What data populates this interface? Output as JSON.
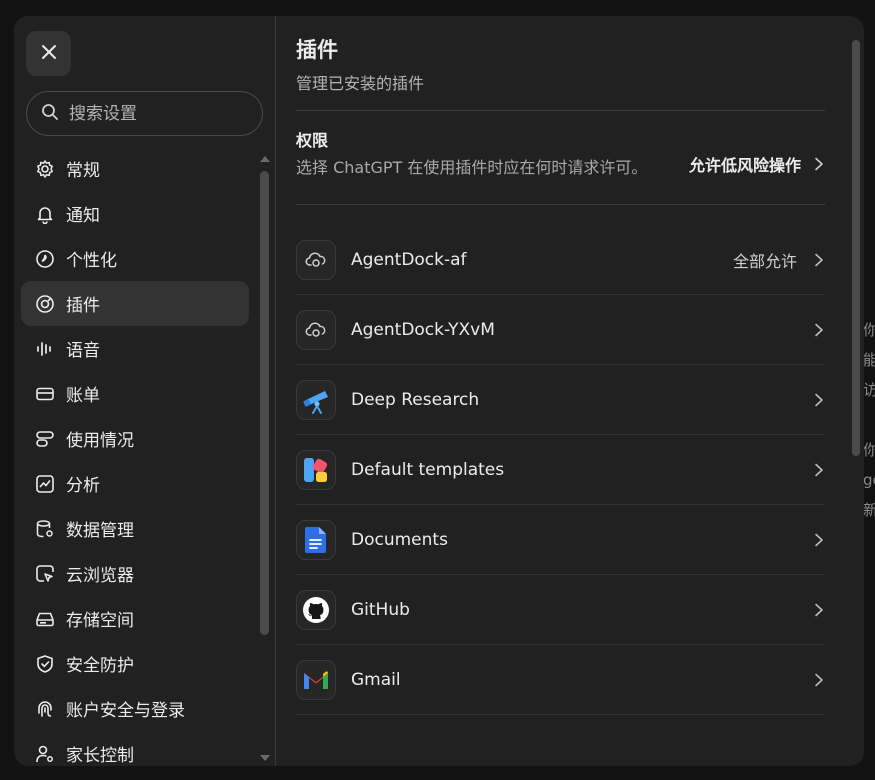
{
  "sidebar": {
    "search_placeholder": "搜索设置",
    "items": [
      {
        "label": "常规",
        "icon": "gear-icon"
      },
      {
        "label": "通知",
        "icon": "bell-icon"
      },
      {
        "label": "个性化",
        "icon": "personalization-icon"
      },
      {
        "label": "插件",
        "icon": "plugin-icon",
        "active": true
      },
      {
        "label": "语音",
        "icon": "voice-waveform-icon"
      },
      {
        "label": "账单",
        "icon": "credit-card-icon"
      },
      {
        "label": "使用情况",
        "icon": "usage-bars-icon"
      },
      {
        "label": "分析",
        "icon": "analytics-chart-icon"
      },
      {
        "label": "数据管理",
        "icon": "database-gear-icon"
      },
      {
        "label": "云浏览器",
        "icon": "cloud-browser-icon"
      },
      {
        "label": "存储空间",
        "icon": "storage-drive-icon"
      },
      {
        "label": "安全防护",
        "icon": "shield-icon"
      },
      {
        "label": "账户安全与登录",
        "icon": "fingerprint-icon"
      },
      {
        "label": "家长控制",
        "icon": "parental-control-icon"
      }
    ]
  },
  "header": {
    "title": "插件",
    "subtitle": "管理已安装的插件"
  },
  "permissions": {
    "title": "权限",
    "description": "选择 ChatGPT 在使用插件时应在何时请求许可。",
    "value": "允许低风险操作"
  },
  "plugins": [
    {
      "name": "AgentDock-af",
      "status": "全部允许",
      "icon": "agentdock-icon"
    },
    {
      "name": "AgentDock-YXvM",
      "status": "",
      "icon": "agentdock-icon"
    },
    {
      "name": "Deep Research",
      "status": "",
      "icon": "telescope-icon"
    },
    {
      "name": "Default templates",
      "status": "",
      "icon": "templates-icon"
    },
    {
      "name": "Documents",
      "status": "",
      "icon": "document-icon"
    },
    {
      "name": "GitHub",
      "status": "",
      "icon": "github-icon"
    },
    {
      "name": "Gmail",
      "status": "",
      "icon": "gmail-icon"
    }
  ],
  "colors": {
    "background": "#121212",
    "panel": "#212121",
    "active_item": "#333333",
    "text_primary": "#ececec",
    "text_secondary": "#b4b4b4"
  }
}
